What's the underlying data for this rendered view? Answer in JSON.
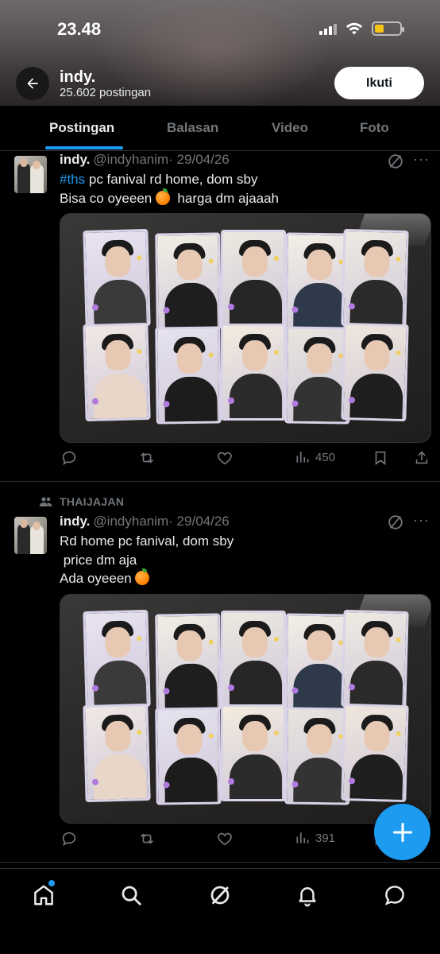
{
  "status_bar": {
    "time": "23.48"
  },
  "profile": {
    "name": "indy.",
    "post_count": "25.602 postingan",
    "follow_label": "Ikuti"
  },
  "tabs": [
    {
      "label": "Postingan",
      "active": true
    },
    {
      "label": "Balasan",
      "active": false
    },
    {
      "label": "Video",
      "active": false
    },
    {
      "label": "Foto",
      "active": false
    }
  ],
  "posts": [
    {
      "repost_label": "",
      "name": "indy.",
      "handle": "@indyhanim",
      "date": "· 29/04/26",
      "hashtag": "#ths",
      "line1_rest": " pc fanival rd home, dom sby",
      "line2_before": "Bisa co oyeeen ",
      "line2_after": "  harga dm ajaaah",
      "stats": {
        "replies": "",
        "reposts": "",
        "likes": "",
        "views": "450"
      }
    },
    {
      "repost_label": "THAIJAJAN",
      "name": "indy.",
      "handle": "@indyhanim",
      "date": "· 29/04/26",
      "line1": "Rd home pc fanival, dom sby",
      "line2": " price dm aja",
      "line3_before": "Ada oyeeen ",
      "stats": {
        "replies": "",
        "reposts": "",
        "likes": "",
        "views": "391"
      }
    }
  ],
  "icons": {
    "back": "arrow-left-icon",
    "grok": "grok-icon",
    "more": "more-icon",
    "reply": "reply-icon",
    "repost": "repost-icon",
    "like": "heart-icon",
    "views": "views-icon",
    "bookmark": "bookmark-icon",
    "share": "share-icon",
    "compose": "plus-icon",
    "home": "home-icon",
    "search": "search-icon",
    "notifications": "bell-icon",
    "messages": "message-icon"
  },
  "colors": {
    "accent": "#1d9bf0",
    "background": "#000000",
    "muted": "#71767b"
  }
}
